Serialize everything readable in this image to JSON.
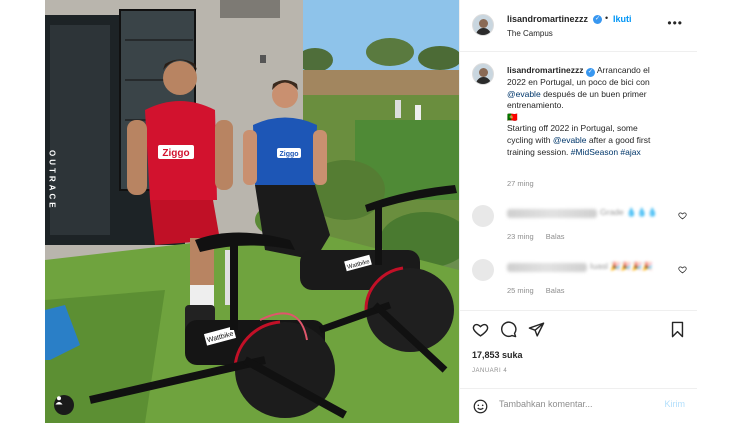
{
  "post": {
    "username": "lisandromartinezzz",
    "follow_label": "Ikuti",
    "location": "The Campus",
    "caption": {
      "username": "lisandromartinezzz",
      "line_es_1": "Arrancando el",
      "line_es_2": "2022 en Portugal, un poco de bici con",
      "tagged_user": "@evable",
      "line_es_3": "después de un buen primer",
      "line_es_4": "entrenamiento.",
      "emoji_line": "🇵🇹",
      "line_en_1": "Starting off 2022 in Portugal, some",
      "line_en_2": "cycling with",
      "tagged_user_2": "@evable",
      "line_en_3": "after a good first",
      "line_en_4": "training session.",
      "hashtags": "#MidSeason #ajax"
    },
    "caption_time": "27 ming",
    "comments": [
      {
        "text": "Grade 💧💧💧",
        "time": "23 ming",
        "reply": "Balas"
      },
      {
        "text": "Iuasl 🎉🎉🎉🎉",
        "time": "25 ming",
        "reply": "Balas"
      }
    ],
    "likes": "17,853 suka",
    "date": "JANUARI 4",
    "add_comment_placeholder": "Tambahkan komentar...",
    "post_label": "Kirim"
  },
  "photo": {
    "shirt_brand": "Ziggo",
    "wall_text": "OUTRACE",
    "bike_brand": "Wattbike"
  },
  "colors": {
    "accent_blue": "#0095f6",
    "verified_blue": "#3897f0",
    "ajax_red": "#d2122e"
  },
  "icons": [
    "verified-icon",
    "more-icon",
    "heart-icon",
    "comment-icon",
    "share-icon",
    "bookmark-icon",
    "emoji-icon",
    "user-tag-icon"
  ]
}
